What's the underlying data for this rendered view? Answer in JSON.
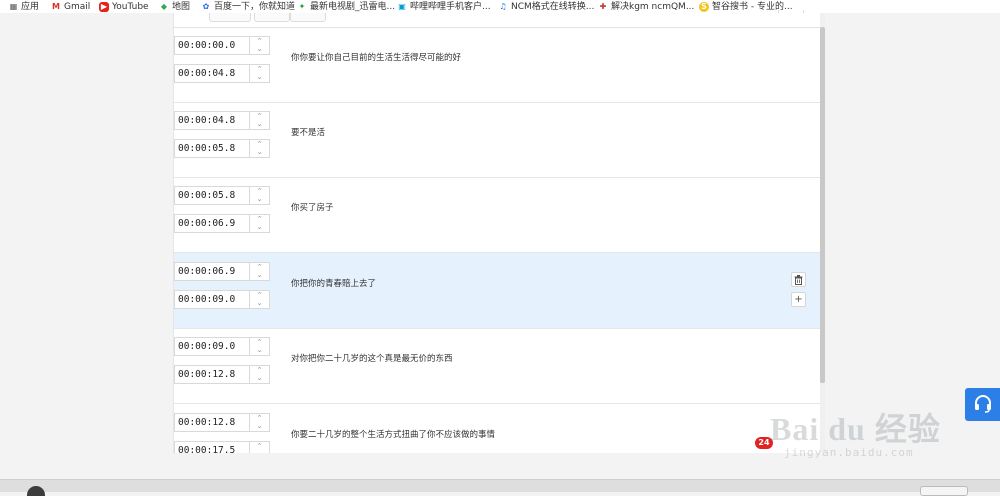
{
  "bookmarks": [
    {
      "label": "应用",
      "icon": "apps-grid-icon"
    },
    {
      "label": "Gmail",
      "icon": "gmail-icon"
    },
    {
      "label": "YouTube",
      "icon": "youtube-icon"
    },
    {
      "label": "地图",
      "icon": "maps-icon"
    },
    {
      "label": "百度一下，你就知道",
      "icon": "baidu-icon"
    },
    {
      "label": "最新电视剧_迅雷电...",
      "icon": "xunlei-icon"
    },
    {
      "label": "哔哩哔哩手机客户...",
      "icon": "bilibili-icon"
    },
    {
      "label": "NCM格式在线转换...",
      "icon": "music-note-icon"
    },
    {
      "label": "解决kgm ncmQM...",
      "icon": "kgm-icon"
    },
    {
      "label": "智谷搜书 - 专业的...",
      "icon": "zhigu-icon"
    }
  ],
  "subtitles": [
    {
      "start": "00:00:00.0",
      "end": "00:00:04.8",
      "text": "你你要让你自己目前的生活生活得尽可能的好"
    },
    {
      "start": "00:00:04.8",
      "end": "00:00:05.8",
      "text": "要不是活"
    },
    {
      "start": "00:00:05.8",
      "end": "00:00:06.9",
      "text": "你买了房子"
    },
    {
      "start": "00:00:06.9",
      "end": "00:00:09.0",
      "text": "你把你的青春賠上去了"
    },
    {
      "start": "00:00:09.0",
      "end": "00:00:12.8",
      "text": "对你把你二十几岁的这个真是最无价的东西"
    },
    {
      "start": "00:00:12.8",
      "end": "00:00:17.5",
      "text": "你要二十几岁的整个生活方式扭曲了你不应该做的事情"
    }
  ],
  "active_row_index": 3,
  "row_actions": {
    "delete_icon": "trash-icon",
    "add_label": "+"
  },
  "stepper": {
    "up": "⌃",
    "down": "⌄"
  },
  "notification_count": "24",
  "watermark": {
    "logo": "Bai du 经验",
    "url": "jingyan.baidu.com"
  },
  "colors": {
    "active_row": "#e6f1fe",
    "support_button": "#2d7fe8",
    "badge": "#e02424"
  }
}
